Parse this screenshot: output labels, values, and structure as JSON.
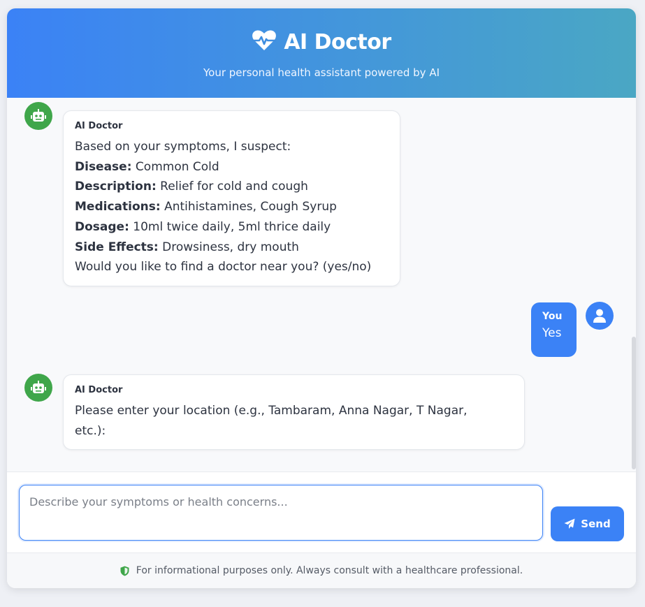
{
  "header": {
    "title": "AI Doctor",
    "subtitle": "Your personal health assistant powered by AI",
    "icon": "heartbeat-icon"
  },
  "messages": [
    {
      "sender": "AI Doctor",
      "role": "bot",
      "intro": "Based on your symptoms, I suspect:",
      "fields": [
        {
          "label": "Disease:",
          "value": "Common Cold"
        },
        {
          "label": "Description:",
          "value": "Relief for cold and cough"
        },
        {
          "label": "Medications:",
          "value": "Antihistamines, Cough Syrup"
        },
        {
          "label": "Dosage:",
          "value": "10ml twice daily, 5ml thrice daily"
        },
        {
          "label": "Side Effects:",
          "value": "Drowsiness, dry mouth"
        }
      ],
      "outro": "Would you like to find a doctor near you? (yes/no)"
    },
    {
      "sender": "You",
      "role": "user",
      "text": "Yes"
    },
    {
      "sender": "AI Doctor",
      "role": "bot",
      "line1": "Please enter your location (e.g., Tambaram, Anna Nagar, T Nagar,",
      "line2": "etc.):"
    }
  ],
  "composer": {
    "placeholder": "Describe your symptoms or health concerns...",
    "value": "",
    "send_label": "Send"
  },
  "footer": {
    "disclaimer": "For informational purposes only. Always consult with a healthcare professional.",
    "icon": "shield-icon"
  },
  "colors": {
    "primary": "#3b82f6",
    "header_gradient_end": "#4aa7c4",
    "bot_avatar": "#3fa64a"
  }
}
